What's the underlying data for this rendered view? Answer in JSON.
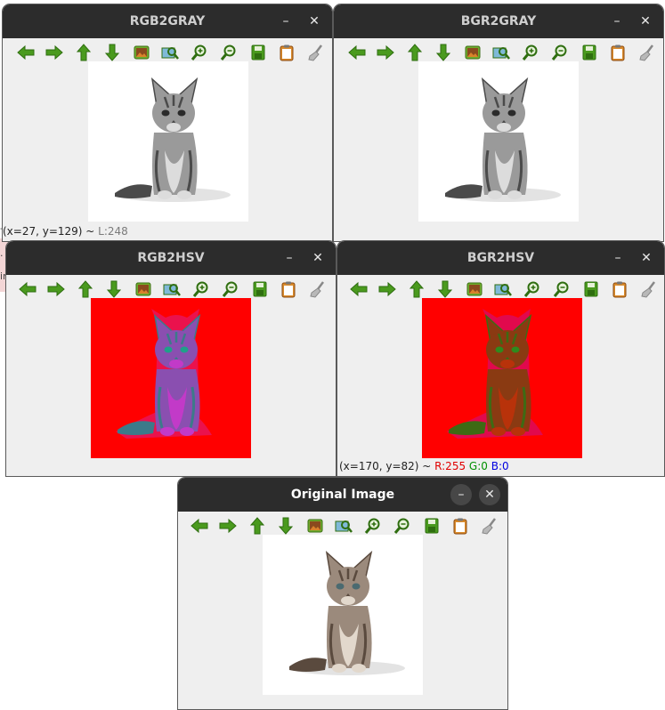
{
  "background": {
    "glyphs": [
      "-",
      ".",
      "ir"
    ]
  },
  "toolbar_icons": [
    "arrow-left-icon",
    "arrow-right-icon",
    "arrow-up-icon",
    "arrow-down-icon",
    "image-icon",
    "zoom-fit-icon",
    "zoom-in-icon",
    "zoom-out-icon",
    "save-icon",
    "clipboard-icon",
    "brush-icon"
  ],
  "windows": {
    "rgb2gray": {
      "title": "RGB2GRAY",
      "min": "–",
      "close": "✕",
      "status": {
        "coords": "(x=27, y=129) ~ ",
        "value_label": "L:248"
      }
    },
    "bgr2gray": {
      "title": "BGR2GRAY",
      "min": "–",
      "close": "✕"
    },
    "rgb2hsv": {
      "title": "RGB2HSV",
      "min": "–",
      "close": "✕"
    },
    "bgr2hsv": {
      "title": "BGR2HSV",
      "min": "–",
      "close": "✕",
      "status": {
        "coords": "(x=170, y=82) ~ ",
        "r": "R:255",
        "g": "G:0",
        "b": "B:0"
      }
    },
    "original": {
      "title": "Original Image",
      "min": "–",
      "close": "✕"
    }
  },
  "colors": {
    "titlebar": "#2c2c2c",
    "window_bg": "#efefef",
    "hsv_red": "#ff0000",
    "icon_green": "#4a9a1e"
  }
}
